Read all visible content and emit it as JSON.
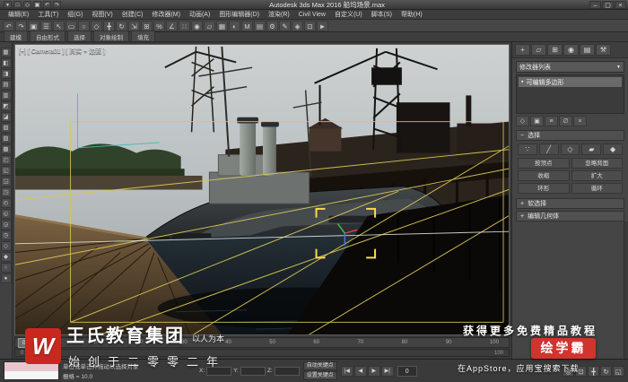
{
  "title_bar": {
    "qat": [
      "▾",
      "□",
      "◇",
      "▣",
      "↶",
      "↷"
    ],
    "title": "Autodesk 3ds Max 2016  船坞场景.max",
    "min": "–",
    "max": "▢",
    "close": "×"
  },
  "menu_bar": {
    "items": [
      "编辑(E)",
      "工具(T)",
      "组(G)",
      "视图(V)",
      "创建(C)",
      "修改器(M)",
      "动画(A)",
      "图形编辑器(D)",
      "渲染(R)",
      "Civil View",
      "自定义(U)",
      "脚本(S)",
      "帮助(H)"
    ]
  },
  "main_toolbar": {
    "icons": [
      "↶",
      "↷",
      "▣",
      "☰",
      "↖",
      "▭",
      "○",
      "◇",
      "╋",
      "↻",
      "⇲",
      "⊞",
      "%",
      "∠",
      "∷",
      "◉",
      "▱",
      "▦",
      "◐",
      "M",
      "▤",
      "⚙",
      "✎",
      "◈",
      "⊡",
      "►"
    ]
  },
  "ribbon": {
    "tabs": [
      "建模",
      "自由形式",
      "选择",
      "对象绘制",
      "填充"
    ]
  },
  "left_toolbar": {
    "icons": [
      "▦",
      "◧",
      "◨",
      "▤",
      "▥",
      "◩",
      "◪",
      "▧",
      "▨",
      "▩",
      "◰",
      "◱",
      "◲",
      "◳",
      "◴",
      "◵",
      "◶",
      "◷",
      "◇",
      "◆",
      "○",
      "●"
    ]
  },
  "viewport": {
    "label": "[+] [ Camera01 ] [ 真实 + 边面 ]"
  },
  "right_panel": {
    "tabs": [
      "+",
      "▱",
      "⊞",
      "◉",
      "▤",
      "⚒"
    ],
    "modifier_list": "修改器列表",
    "dropdown_arrow": "▼",
    "stack_items": [
      "可编辑多边形"
    ],
    "stack_item_icon": "▪",
    "stack_tools": [
      "◇",
      "▣",
      "≡",
      "∅",
      "×"
    ],
    "rollout_open_glyph": "−",
    "rollout_closed_glyph": "+",
    "selection": {
      "title": "选择",
      "icons": [
        "∵",
        "╱",
        "◇",
        "▰",
        "◆"
      ],
      "buttons": [
        "按顶点",
        "忽略背面",
        "收缩",
        "扩大",
        "环形",
        "循环"
      ]
    },
    "soft_selection_title": "软选择",
    "edit_geometry_title": "编辑几何体"
  },
  "time_slider": {
    "handle": "0 / 100",
    "ticks": [
      "0",
      "10",
      "20",
      "30",
      "40",
      "50",
      "60",
      "70",
      "80",
      "90",
      "100"
    ]
  },
  "track_bar": {
    "start": "0",
    "end": "100"
  },
  "status_bar": {
    "prompt": "单击或单击并拖动以选择对象",
    "grid": "栅格 = 10.0",
    "coord_labels": [
      "X:",
      "Y:",
      "Z:"
    ],
    "auto_key": "自动关键点",
    "set_key": "设置关键点",
    "playback": [
      "|◀",
      "◀",
      "▶",
      "▶|"
    ],
    "frame": "0",
    "nav": [
      "◎",
      "⊡",
      "╋",
      "↻",
      "◱"
    ]
  },
  "watermark": {
    "logo_letter": "W",
    "brand": "王氏教育集团",
    "slogan": "以人为本",
    "since": "始创于二零零二年",
    "promo_top": "获得更多免费精品教程",
    "badge": "绘学霸",
    "promo_bottom": "在AppStore，应用宝搜索下载"
  },
  "colors": {
    "badge_red": "#d0342c",
    "logo_red": "#c8281f",
    "selection_yellow": "#ffd84d"
  }
}
